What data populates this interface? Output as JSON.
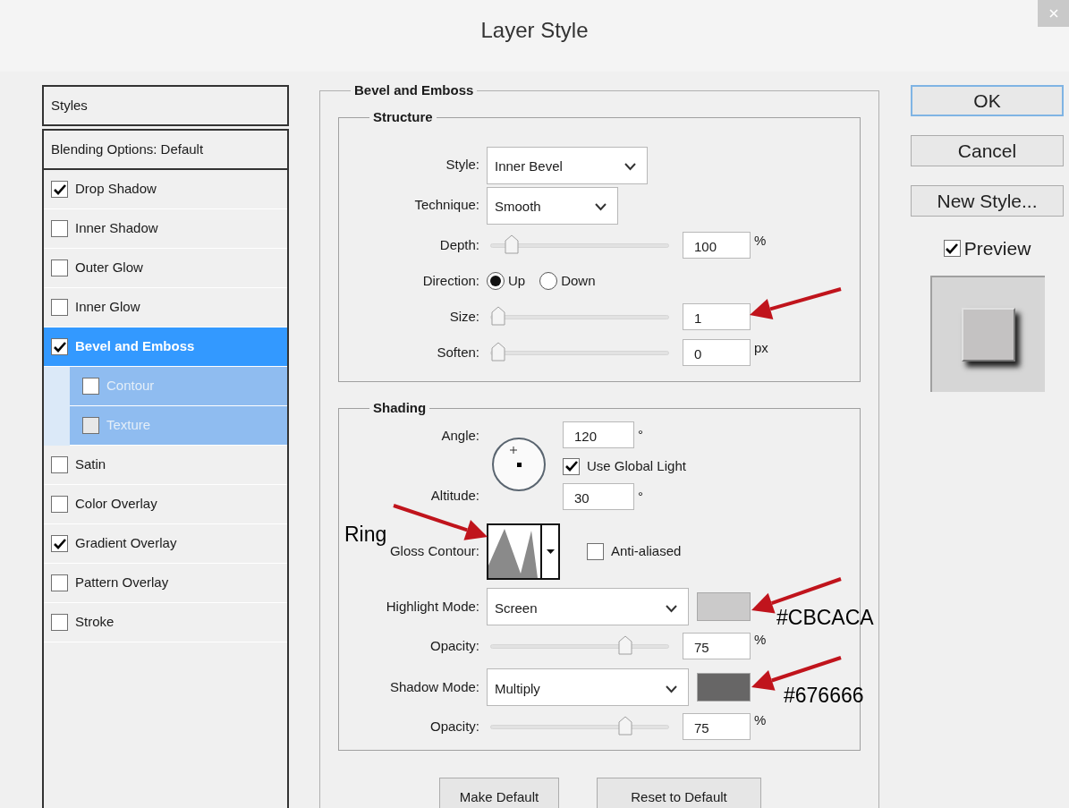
{
  "window": {
    "title": "Layer Style"
  },
  "styles_panel": {
    "header": "Styles",
    "blending": "Blending Options: Default",
    "items": [
      {
        "label": "Drop Shadow",
        "checked": true,
        "selected": false,
        "kind": "main"
      },
      {
        "label": "Inner Shadow",
        "checked": false,
        "selected": false,
        "kind": "main"
      },
      {
        "label": "Outer Glow",
        "checked": false,
        "selected": false,
        "kind": "main"
      },
      {
        "label": "Inner Glow",
        "checked": false,
        "selected": false,
        "kind": "main"
      },
      {
        "label": "Bevel and Emboss",
        "checked": true,
        "selected": true,
        "kind": "main"
      },
      {
        "label": "Contour",
        "checked": false,
        "selected": false,
        "kind": "sub"
      },
      {
        "label": "Texture",
        "checked": false,
        "selected": false,
        "kind": "sub"
      },
      {
        "label": "Satin",
        "checked": false,
        "selected": false,
        "kind": "main"
      },
      {
        "label": "Color Overlay",
        "checked": false,
        "selected": false,
        "kind": "main"
      },
      {
        "label": "Gradient Overlay",
        "checked": true,
        "selected": false,
        "kind": "main"
      },
      {
        "label": "Pattern Overlay",
        "checked": false,
        "selected": false,
        "kind": "main"
      },
      {
        "label": "Stroke",
        "checked": false,
        "selected": false,
        "kind": "main"
      }
    ]
  },
  "bevel_and_emboss": {
    "title": "Bevel and Emboss",
    "structure": {
      "title": "Structure",
      "style": {
        "label": "Style:",
        "value": "Inner Bevel"
      },
      "technique": {
        "label": "Technique:",
        "value": "Smooth"
      },
      "depth": {
        "label": "Depth:",
        "value": "100",
        "unit": "%",
        "level": 0.08
      },
      "direction": {
        "label": "Direction:",
        "options": [
          {
            "label": "Up",
            "selected": true
          },
          {
            "label": "Down",
            "selected": false
          }
        ]
      },
      "size": {
        "label": "Size:",
        "value": "1",
        "level": 0
      },
      "soften": {
        "label": "Soften:",
        "value": "0",
        "unit": "px",
        "level": 0
      }
    },
    "shading": {
      "title": "Shading",
      "angle": {
        "label": "Angle:",
        "value": "120",
        "unit": "°"
      },
      "use_global_light": {
        "label": "Use Global Light",
        "checked": true
      },
      "altitude": {
        "label": "Altitude:",
        "value": "30",
        "unit": "°"
      },
      "gloss_contour": {
        "label": "Gloss Contour:"
      },
      "anti_aliased": {
        "label": "Anti-aliased",
        "checked": false
      },
      "highlight_mode": {
        "label": "Highlight Mode:",
        "value": "Screen",
        "color": "#cbcaca"
      },
      "highlight_opacity": {
        "label": "Opacity:",
        "value": "75",
        "unit": "%",
        "level": 0.77
      },
      "shadow_mode": {
        "label": "Shadow Mode:",
        "value": "Multiply",
        "color": "#676666"
      },
      "shadow_opacity": {
        "label": "Opacity:",
        "value": "75",
        "unit": "%",
        "level": 0.77
      }
    },
    "buttons": [
      {
        "label": "Make Default"
      },
      {
        "label": "Reset to Default"
      }
    ]
  },
  "side_buttons": [
    {
      "label": "OK",
      "selected": true
    },
    {
      "label": "Cancel",
      "selected": false
    },
    {
      "label": "New Style...",
      "selected": false
    }
  ],
  "preview": {
    "label": "Preview",
    "checked": true
  },
  "annotations": [
    {
      "text": "Ring"
    },
    {
      "text": "#CBCACA"
    },
    {
      "text": "#676666"
    }
  ]
}
